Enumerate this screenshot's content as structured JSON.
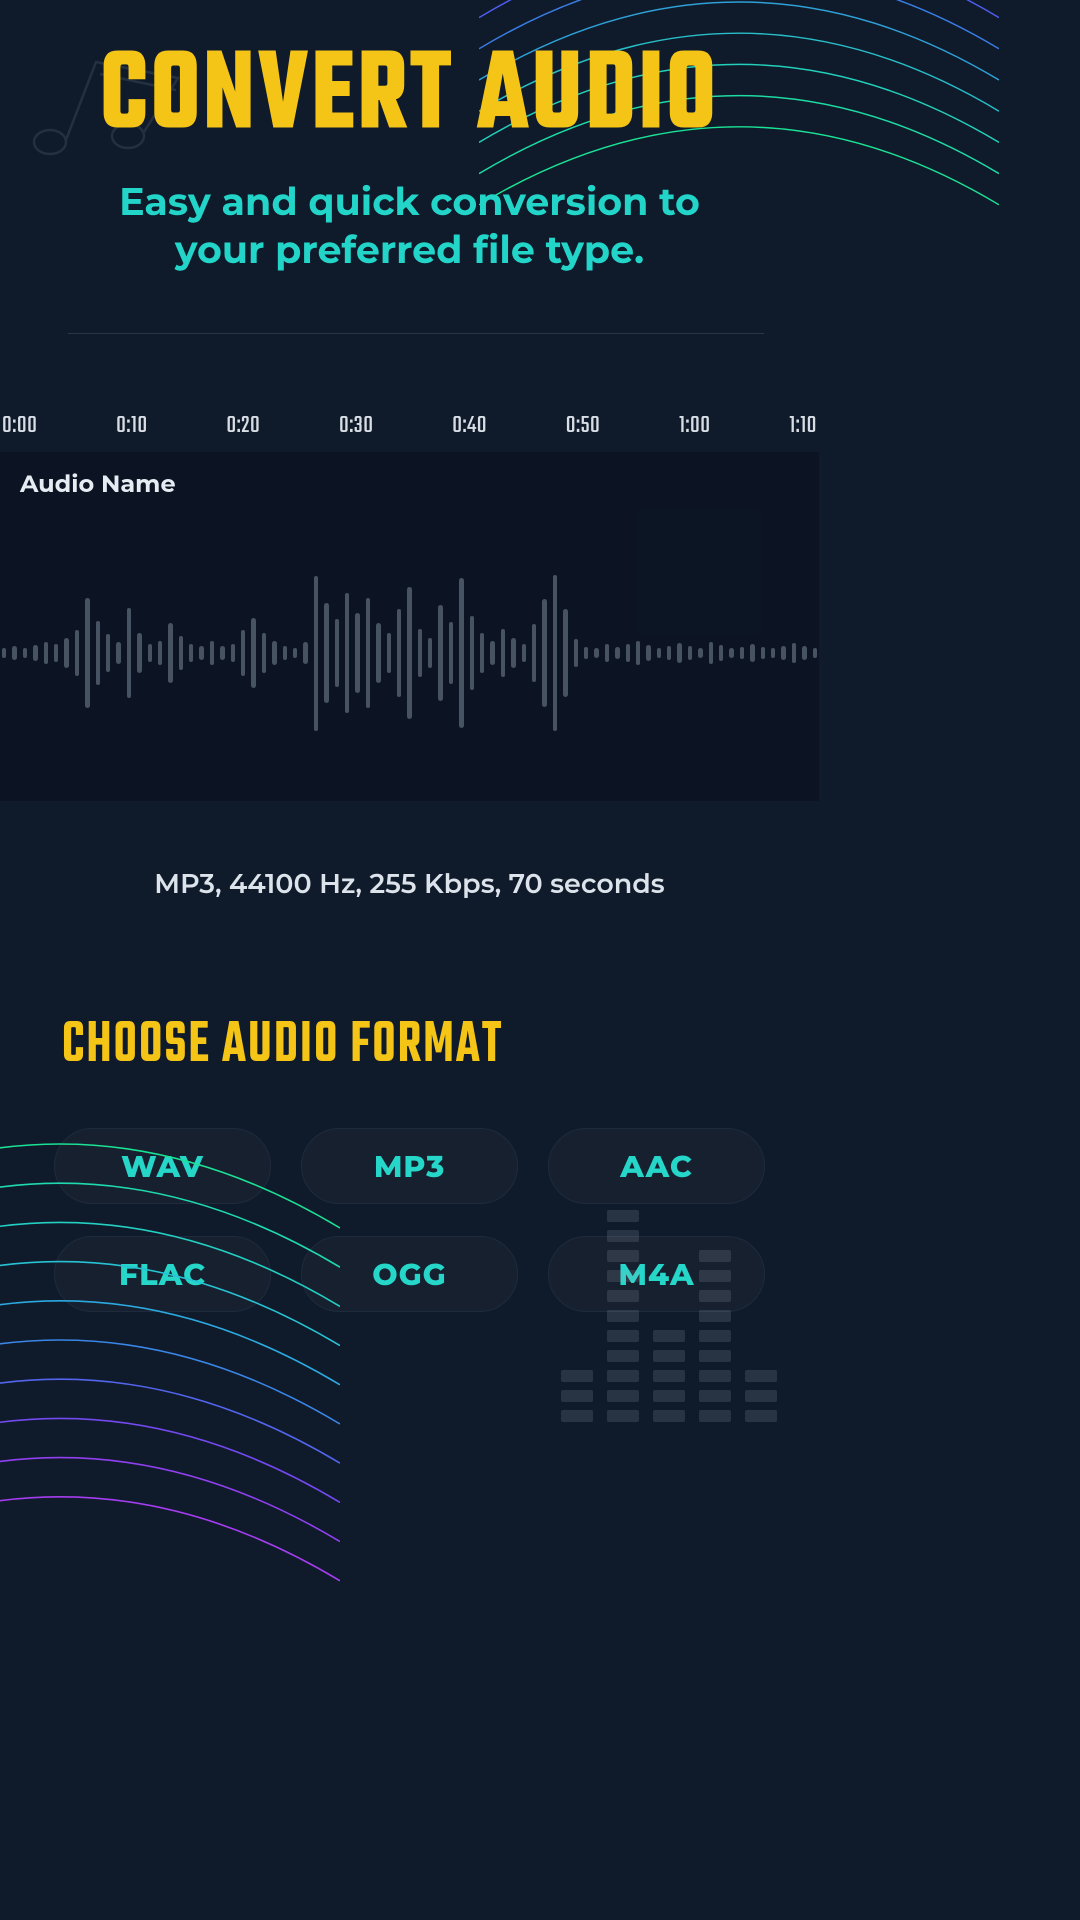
{
  "header": {
    "title": "CONVERT AUDIO",
    "subtitle": "Easy and quick conversion to your preferred file type."
  },
  "timeline": {
    "ticks": [
      "0:00",
      "0:10",
      "0:20",
      "0:30",
      "0:40",
      "0:50",
      "1:00",
      "1:10"
    ]
  },
  "track": {
    "name_label": "Audio Name",
    "meta": "MP3, 44100 Hz, 255 Kbps, 70 seconds"
  },
  "format_section": {
    "heading": "CHOOSE AUDIO FORMAT",
    "options": [
      "WAV",
      "MP3",
      "AAC",
      "FLAC",
      "OGG",
      "M4A"
    ]
  },
  "colors": {
    "accent_yellow": "#f4c417",
    "accent_cyan": "#23d5c8",
    "bg": "#0f1a2b"
  }
}
